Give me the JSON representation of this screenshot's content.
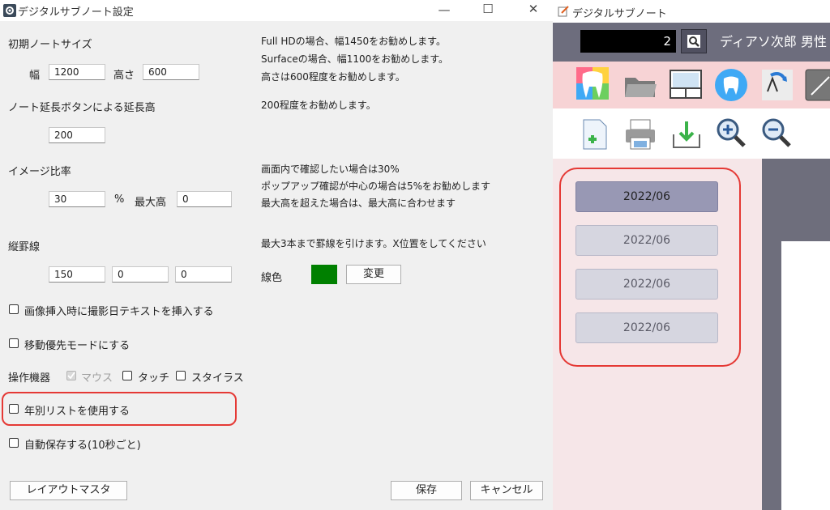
{
  "settings_dialog": {
    "title": "デジタルサブノート設定",
    "window_controls": {
      "minimize": "—",
      "maximize": "☐",
      "close": "✕"
    },
    "note_size": {
      "heading": "初期ノートサイズ",
      "width_label": "幅",
      "width_value": "1200",
      "height_label": "高さ",
      "height_value": "600",
      "hints": [
        "Full HDの場合、幅1450をお勧めします。",
        "Surfaceの場合、幅1100をお勧めします。",
        "高さは600程度をお勧めします。"
      ]
    },
    "extend": {
      "heading": "ノート延長ボタンによる延長高",
      "value": "200",
      "hint": "200程度をお勧めします。"
    },
    "image_ratio": {
      "heading": "イメージ比率",
      "value": "30",
      "percent_label": "%",
      "max_height_label": "最大高",
      "max_height_value": "0",
      "hints": [
        "画面内で確認したい場合は30%",
        "ポップアップ確認が中心の場合は5%をお勧めします",
        "最大高を超えた場合は、最大高に合わせます"
      ]
    },
    "rules": {
      "heading": "縦罫線",
      "values": [
        "150",
        "0",
        "0"
      ],
      "hint": "最大3本まで罫線を引けます。X位置をしてください",
      "color_label": "線色",
      "color": "#008000",
      "change_button": "変更"
    },
    "checkboxes": {
      "insert_date": "画像挿入時に撮影日テキストを挿入する",
      "move_priority": "移動優先モードにする",
      "yearly_list": "年別リストを使用する",
      "autosave": "自動保存する(10秒ごと)"
    },
    "devices": {
      "label": "操作機器",
      "mouse": "マウス",
      "touch": "タッチ",
      "stylus": "スタイラス"
    },
    "buttons": {
      "layout_master": "レイアウトマスタ",
      "save": "保存",
      "cancel": "キャンセル"
    },
    "highlight_color": "#e53935"
  },
  "app_window": {
    "title": "デジタルサブノート",
    "patient_id": "2",
    "patient_name": "ディアソ次郎 男性",
    "year_list": [
      "2022/06",
      "2022/06",
      "2022/06",
      "2022/06"
    ],
    "toolbar_icons": [
      "tooth-logo-icon",
      "folder-icon",
      "layout-icon",
      "tooth-icon",
      "arrow-icon",
      "pen-icon"
    ],
    "toolbar2_icons": [
      "new-page-icon",
      "print-icon",
      "download-icon",
      "zoom-in-icon",
      "zoom-out-icon"
    ]
  }
}
